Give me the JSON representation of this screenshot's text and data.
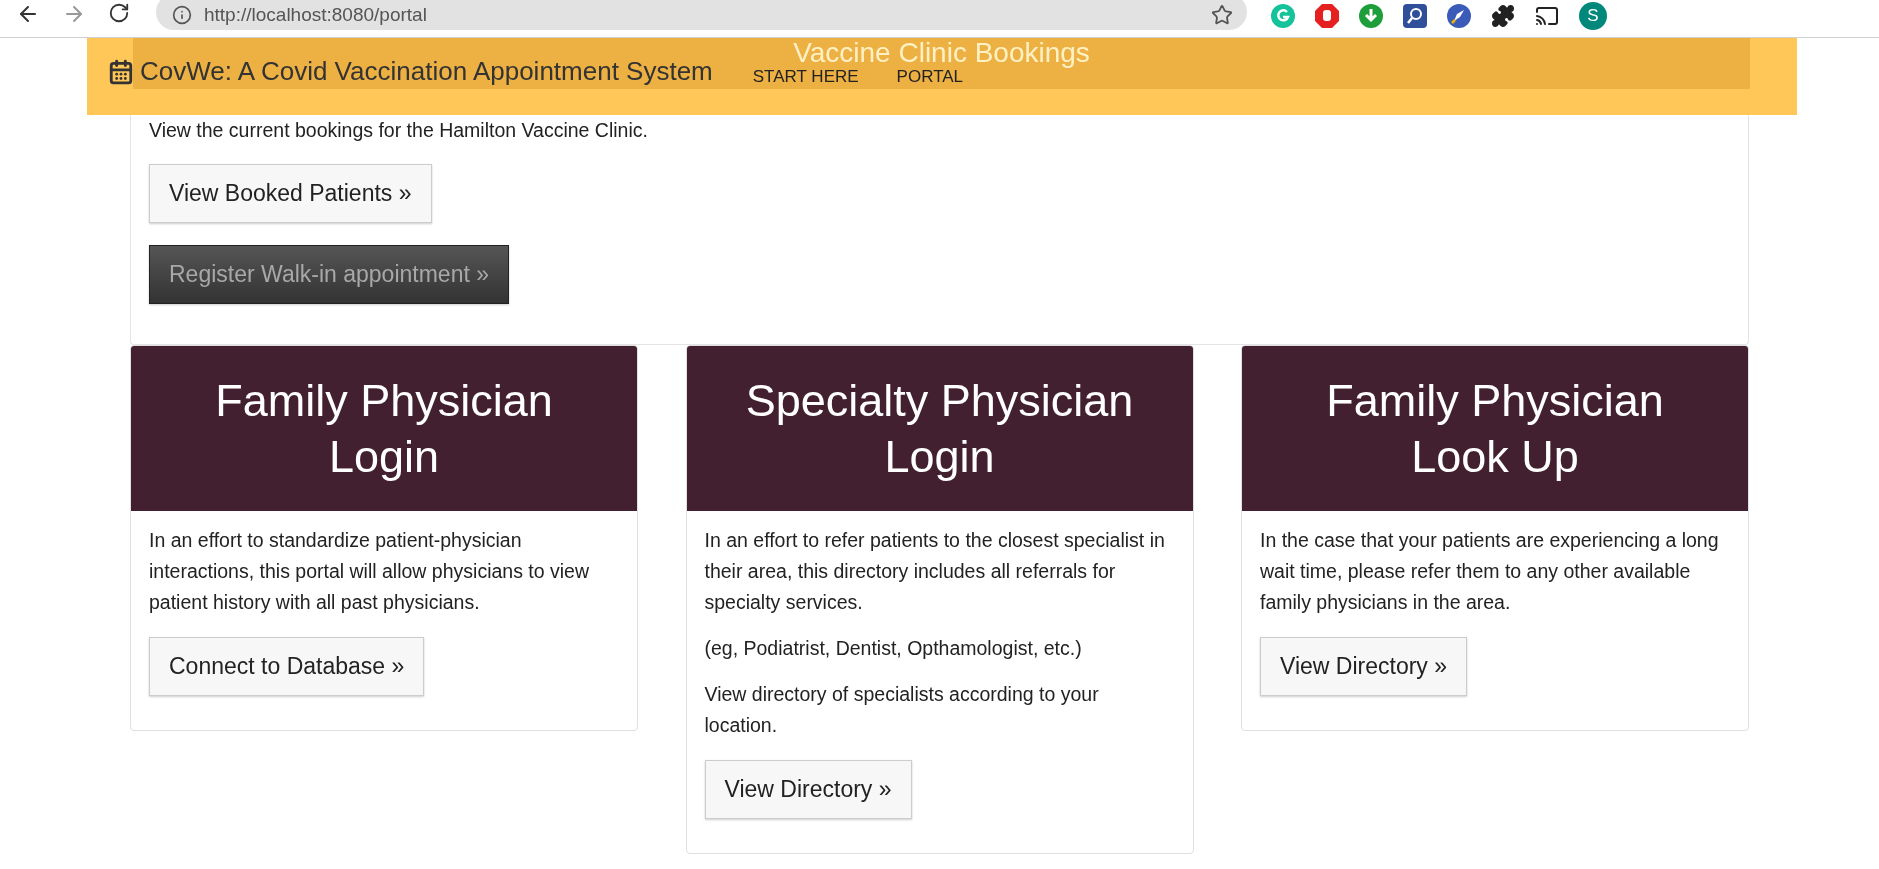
{
  "browser": {
    "url": "http://localhost:8080/portal",
    "profile_initial": "S"
  },
  "navbar": {
    "brand": "CovWe: A Covid Vaccination Appointment System",
    "hidden_heading": "Vaccine Clinic Bookings",
    "links": [
      {
        "label": "START HERE"
      },
      {
        "label": "PORTAL"
      }
    ]
  },
  "bookings": {
    "text": "View the current bookings for the Hamilton Vaccine Clinic.",
    "buttons": [
      {
        "label": "View Booked Patients »",
        "kind": "default"
      },
      {
        "label": "Register Walk-in appointment »",
        "kind": "dark"
      }
    ]
  },
  "cards": [
    {
      "title": "Family Physician Login",
      "paragraphs": [
        "In an effort to standardize patient-physician interactions, this portal will allow physicians to view patient history with all past physicians."
      ],
      "button": "Connect to Database »"
    },
    {
      "title": "Specialty Physician Login",
      "paragraphs": [
        "In an effort to refer patients to the closest specialist in their area, this directory includes all referrals for specialty services.",
        "(eg, Podiatrist, Dentist, Opthamologist, etc.)",
        "View directory of specialists according to your location."
      ],
      "button": "View Directory »"
    },
    {
      "title": "Family Physician Look Up",
      "paragraphs": [
        "In the case that your patients are experiencing a long wait time, please refer them to any other available family physicians in the area."
      ],
      "button": "View Directory »"
    }
  ]
}
